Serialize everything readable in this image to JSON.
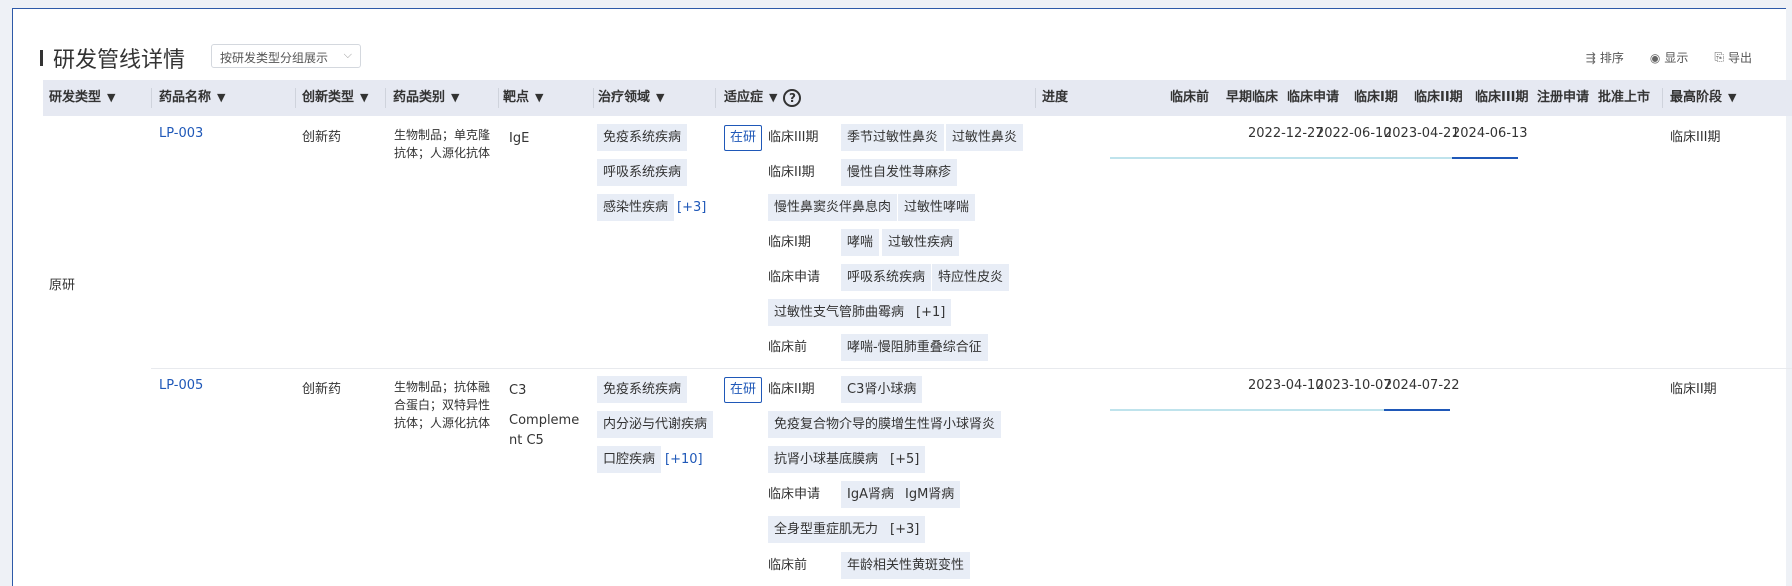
{
  "header": {
    "title": "研发管线详情",
    "group_select": "按研发类型分组展示",
    "actions": [
      {
        "label": "排序",
        "icon": "sort-icon"
      },
      {
        "label": "显示",
        "icon": "eye-icon"
      },
      {
        "label": "导出",
        "icon": "export-icon"
      }
    ]
  },
  "columns": {
    "rd_type": "研发类型",
    "drug_name": "药品名称",
    "innovation_type": "创新类型",
    "drug_category": "药品类别",
    "target": "靶点",
    "therapeutic_area": "治疗领域",
    "indication": "适应症",
    "progress": "进度",
    "stages": [
      "临床前",
      "早期临床",
      "临床申请",
      "临床I期",
      "临床II期",
      "临床III期",
      "注册申请",
      "批准上市"
    ],
    "highest_stage": "最高阶段",
    "help_glyph": "?"
  },
  "group": {
    "rd_type": "原研"
  },
  "rows": [
    {
      "drug_name": "LP-003",
      "innovation_type": "创新药",
      "drug_category": [
        "生物制品；单克隆",
        "抗体；人源化抗体"
      ],
      "target": [
        "IgE"
      ],
      "areas": [
        "免疫系统疾病",
        "呼吸系统疾病",
        "感染性疾病"
      ],
      "areas_more": "[+3]",
      "status": "在研",
      "phases": [
        {
          "phase": "临床III期",
          "tags": [
            "季节过敏性鼻炎",
            "过敏性鼻炎"
          ]
        },
        {
          "phase": "临床II期",
          "tags": [
            "慢性自发性荨麻疹"
          ]
        },
        {
          "phase": "",
          "tags": [
            "慢性鼻窦炎伴鼻息肉",
            "过敏性哮喘"
          ]
        },
        {
          "phase": "临床I期",
          "tags": [
            "哮喘",
            "过敏性疾病"
          ]
        },
        {
          "phase": "临床申请",
          "tags": [
            "呼吸系统疾病",
            "特应性皮炎"
          ]
        },
        {
          "phase": "",
          "tags": [
            "过敏性支气管肺曲霉病"
          ],
          "more": "[+1]"
        },
        {
          "phase": "临床前",
          "tags": [
            "哮喘-慢阻肺重叠综合征"
          ]
        }
      ],
      "dates": [
        "2022-12-27",
        "2022-06-10",
        "2023-04-21",
        "2024-06-13"
      ],
      "highest_stage": "临床III期"
    },
    {
      "drug_name": "LP-005",
      "innovation_type": "创新药",
      "drug_category": [
        "生物制品；抗体融",
        "合蛋白；双特异性",
        "抗体；人源化抗体"
      ],
      "target": [
        "C3",
        "Compleme",
        "nt C5"
      ],
      "areas": [
        "免疫系统疾病",
        "内分泌与代谢疾病",
        "口腔疾病"
      ],
      "areas_more": "[+10]",
      "status": "在研",
      "phases": [
        {
          "phase": "临床II期",
          "tags": [
            "C3肾小球病"
          ]
        },
        {
          "phase": "",
          "tags": [
            "免疫复合物介导的膜增生性肾小球肾炎"
          ]
        },
        {
          "phase": "",
          "tags": [
            "抗肾小球基底膜病"
          ],
          "more": "[+5]"
        },
        {
          "phase": "临床申请",
          "tags": [
            "IgA肾病",
            "IgM肾病"
          ]
        },
        {
          "phase": "",
          "tags": [
            "全身型重症肌无力"
          ],
          "more": "[+3]"
        },
        {
          "phase": "临床前",
          "tags": [
            "年龄相关性黄斑变性"
          ]
        }
      ],
      "dates": [
        "2023-04-10",
        "2023-10-07",
        "2024-07-22"
      ],
      "highest_stage": "临床II期"
    }
  ]
}
